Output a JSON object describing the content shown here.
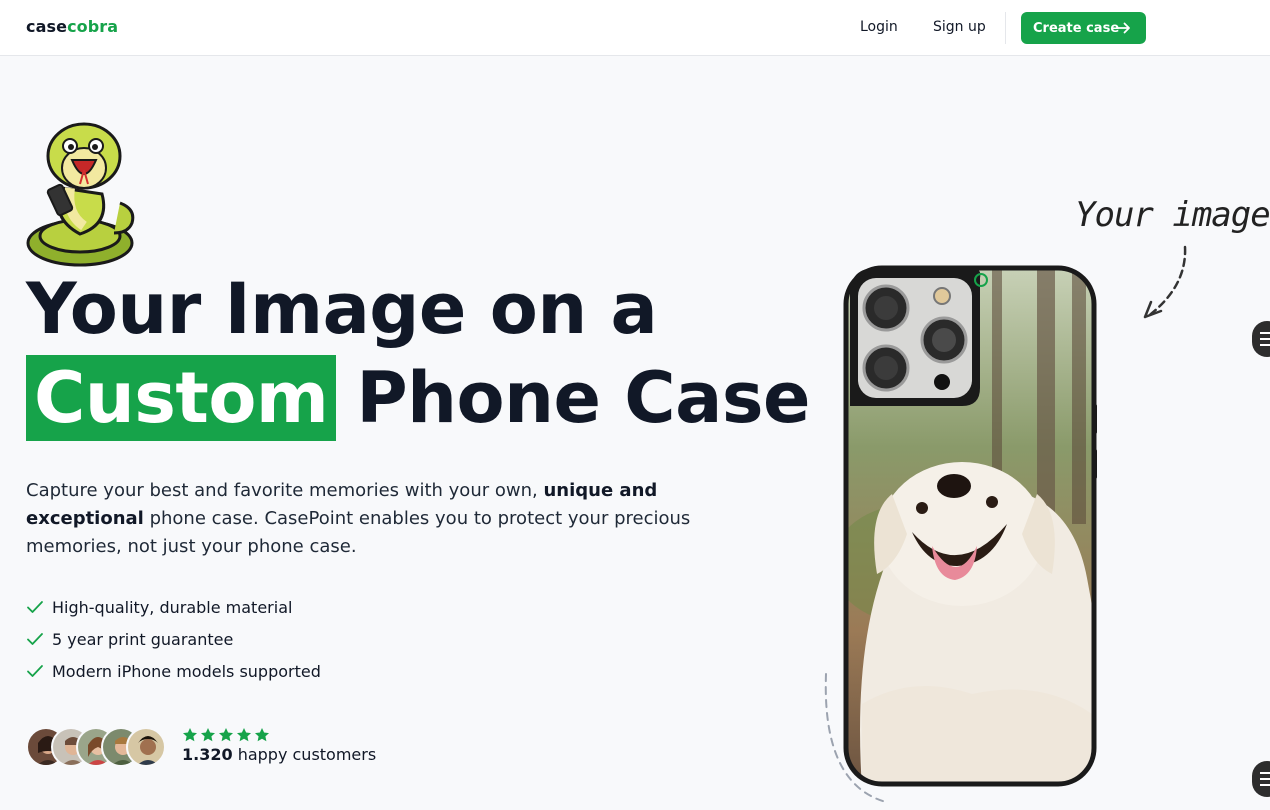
{
  "nav": {
    "logo_part1": "case",
    "logo_part2": "cobra",
    "login": "Login",
    "signup": "Sign up",
    "create_case": "Create case",
    "create_icon": "arrow-right-icon"
  },
  "hero": {
    "title_line1": "Your Image on a",
    "title_highlight": "Custom",
    "title_rest": "Phone Case",
    "desc_part1": "Capture your best and favorite memories with your own, ",
    "desc_bold": "unique and exceptional",
    "desc_part2": " phone case. CasePoint enables you to protect your precious memories, not just your phone case.",
    "features": [
      "High-quality, durable material",
      "5 year print guarantee",
      "Modern iPhone models supported"
    ],
    "rating_stars": 5,
    "customers_count": "1.320",
    "customers_label": " happy customers"
  },
  "showcase": {
    "annotation": "Your image"
  },
  "colors": {
    "brand": "#16a34a",
    "text": "#111827",
    "background": "#f8f9fb"
  }
}
